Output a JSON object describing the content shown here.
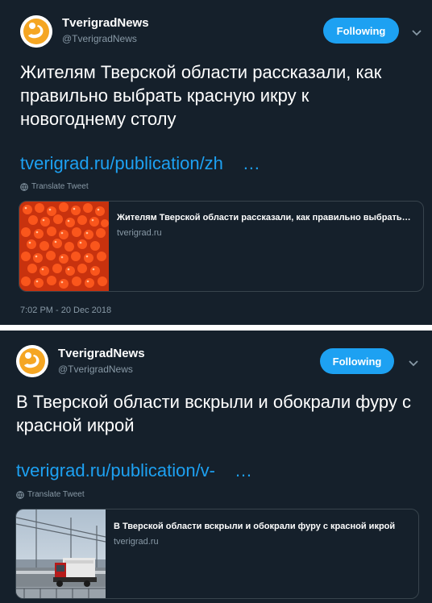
{
  "tweets": [
    {
      "author_name": "TverigradNews",
      "author_handle": "@TverigradNews",
      "follow_label": "Following",
      "text": "Жителям Тверской области рассказали, как правильно выбрать красную икру к новогоднему столу",
      "link_text": "tverigrad.ru/publication/zh",
      "link_ellipsis": "…",
      "translate_label": "Translate Tweet",
      "card_title": "Жителям Тверской области рассказали, как правильно выбрать…",
      "card_domain": "tverigrad.ru",
      "card_image": "red-caviar-photo",
      "timestamp": "7:02 PM - 20 Dec 2018"
    },
    {
      "author_name": "TverigradNews",
      "author_handle": "@TverigradNews",
      "follow_label": "Following",
      "text": "В Тверской области вскрыли и обокрали фуру с красной икрой",
      "link_text": "tverigrad.ru/publication/v-",
      "link_ellipsis": "…",
      "translate_label": "Translate Tweet",
      "card_title": "В Тверской области вскрыли и обокрали фуру с красной икрой",
      "card_domain": "tverigrad.ru",
      "card_image": "truck-on-bridge-photo"
    }
  ],
  "colors": {
    "background": "#15202b",
    "accent": "#1da1f2",
    "muted": "#8899a6",
    "border": "#38444d",
    "logo_orange": "#f5a623"
  }
}
